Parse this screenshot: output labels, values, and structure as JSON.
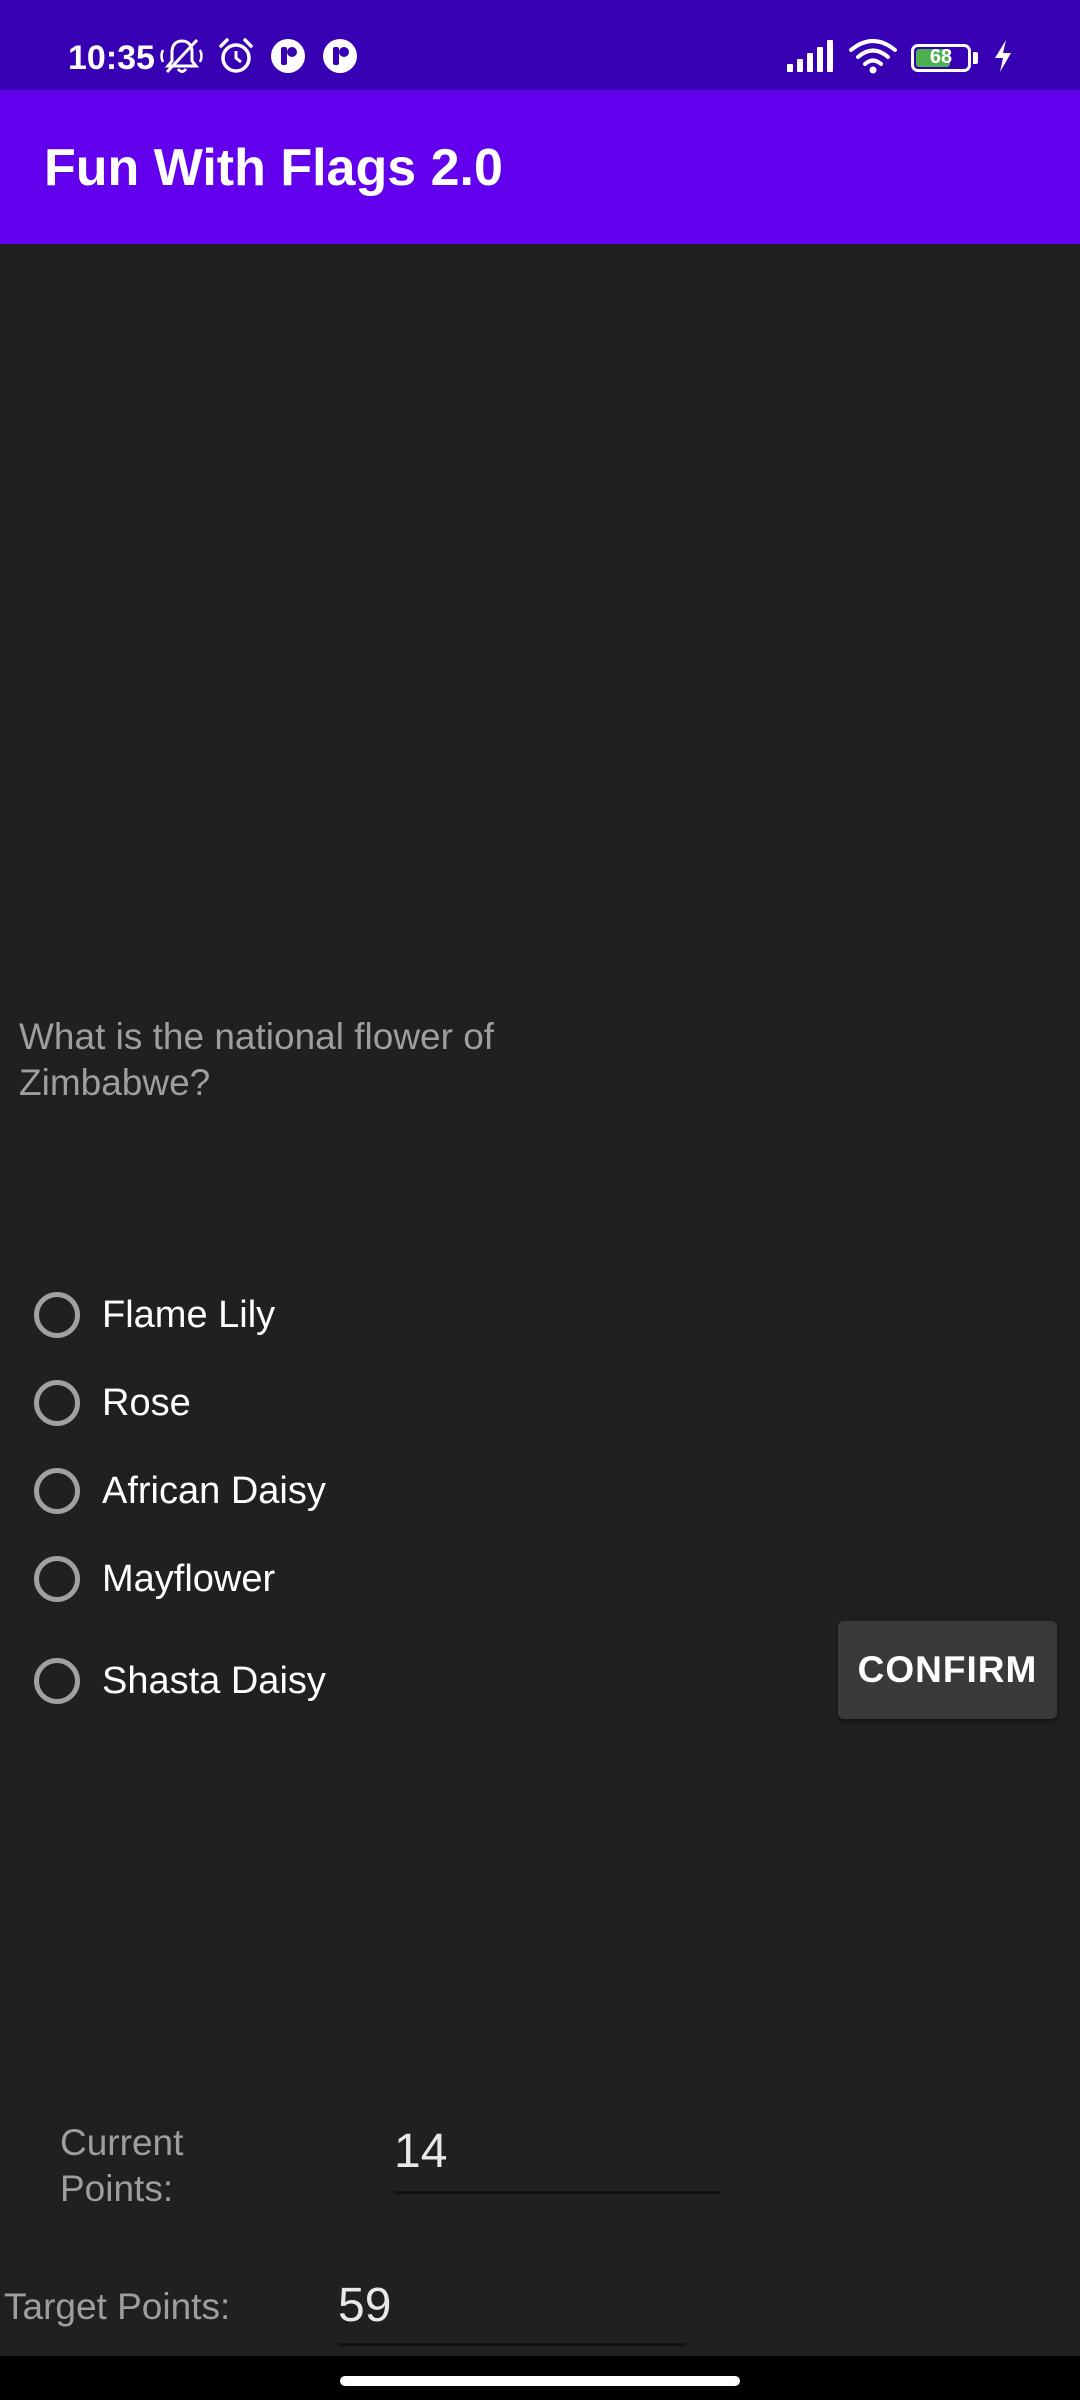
{
  "status_bar": {
    "time": "10:35",
    "left_icons": [
      "notifications-muted-icon",
      "alarm-icon",
      "app-notification-icon",
      "app-notification-icon"
    ],
    "right_icons": [
      "signal-icon",
      "wifi-icon",
      "battery-icon",
      "charging-icon"
    ],
    "battery_level": "68",
    "battery_fraction": 0.68,
    "battery_color": "#4caf50",
    "background": "#3700b3"
  },
  "app_bar": {
    "title": "Fun With Flags 2.0",
    "background": "#6200ee"
  },
  "quiz": {
    "question": "What is the national flower of Zimbabwe?",
    "options": [
      {
        "label": "Flame Lily",
        "selected": false
      },
      {
        "label": "Rose",
        "selected": false
      },
      {
        "label": "African Daisy",
        "selected": false
      },
      {
        "label": "Mayflower",
        "selected": false
      },
      {
        "label": "Shasta Daisy",
        "selected": false
      }
    ],
    "confirm_label": "CONFIRM"
  },
  "scores": {
    "current_label": "Current Points:",
    "current_value": "14",
    "target_label": "Target Points:",
    "target_value": "59"
  }
}
